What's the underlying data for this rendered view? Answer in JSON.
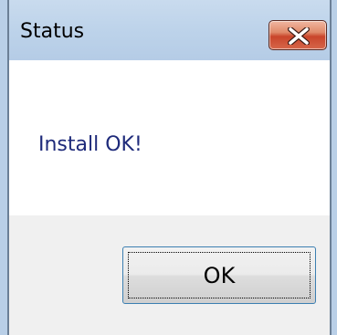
{
  "window": {
    "title": "Status",
    "close_icon": "close-x-icon",
    "colors": {
      "titlebar": "#bdd3ea",
      "close_button": "#c9452b",
      "message_text": "#1e2a7a",
      "button_border": "#3c7fb1"
    }
  },
  "message": {
    "text": "Install OK!"
  },
  "buttons": {
    "ok_label": "OK"
  }
}
